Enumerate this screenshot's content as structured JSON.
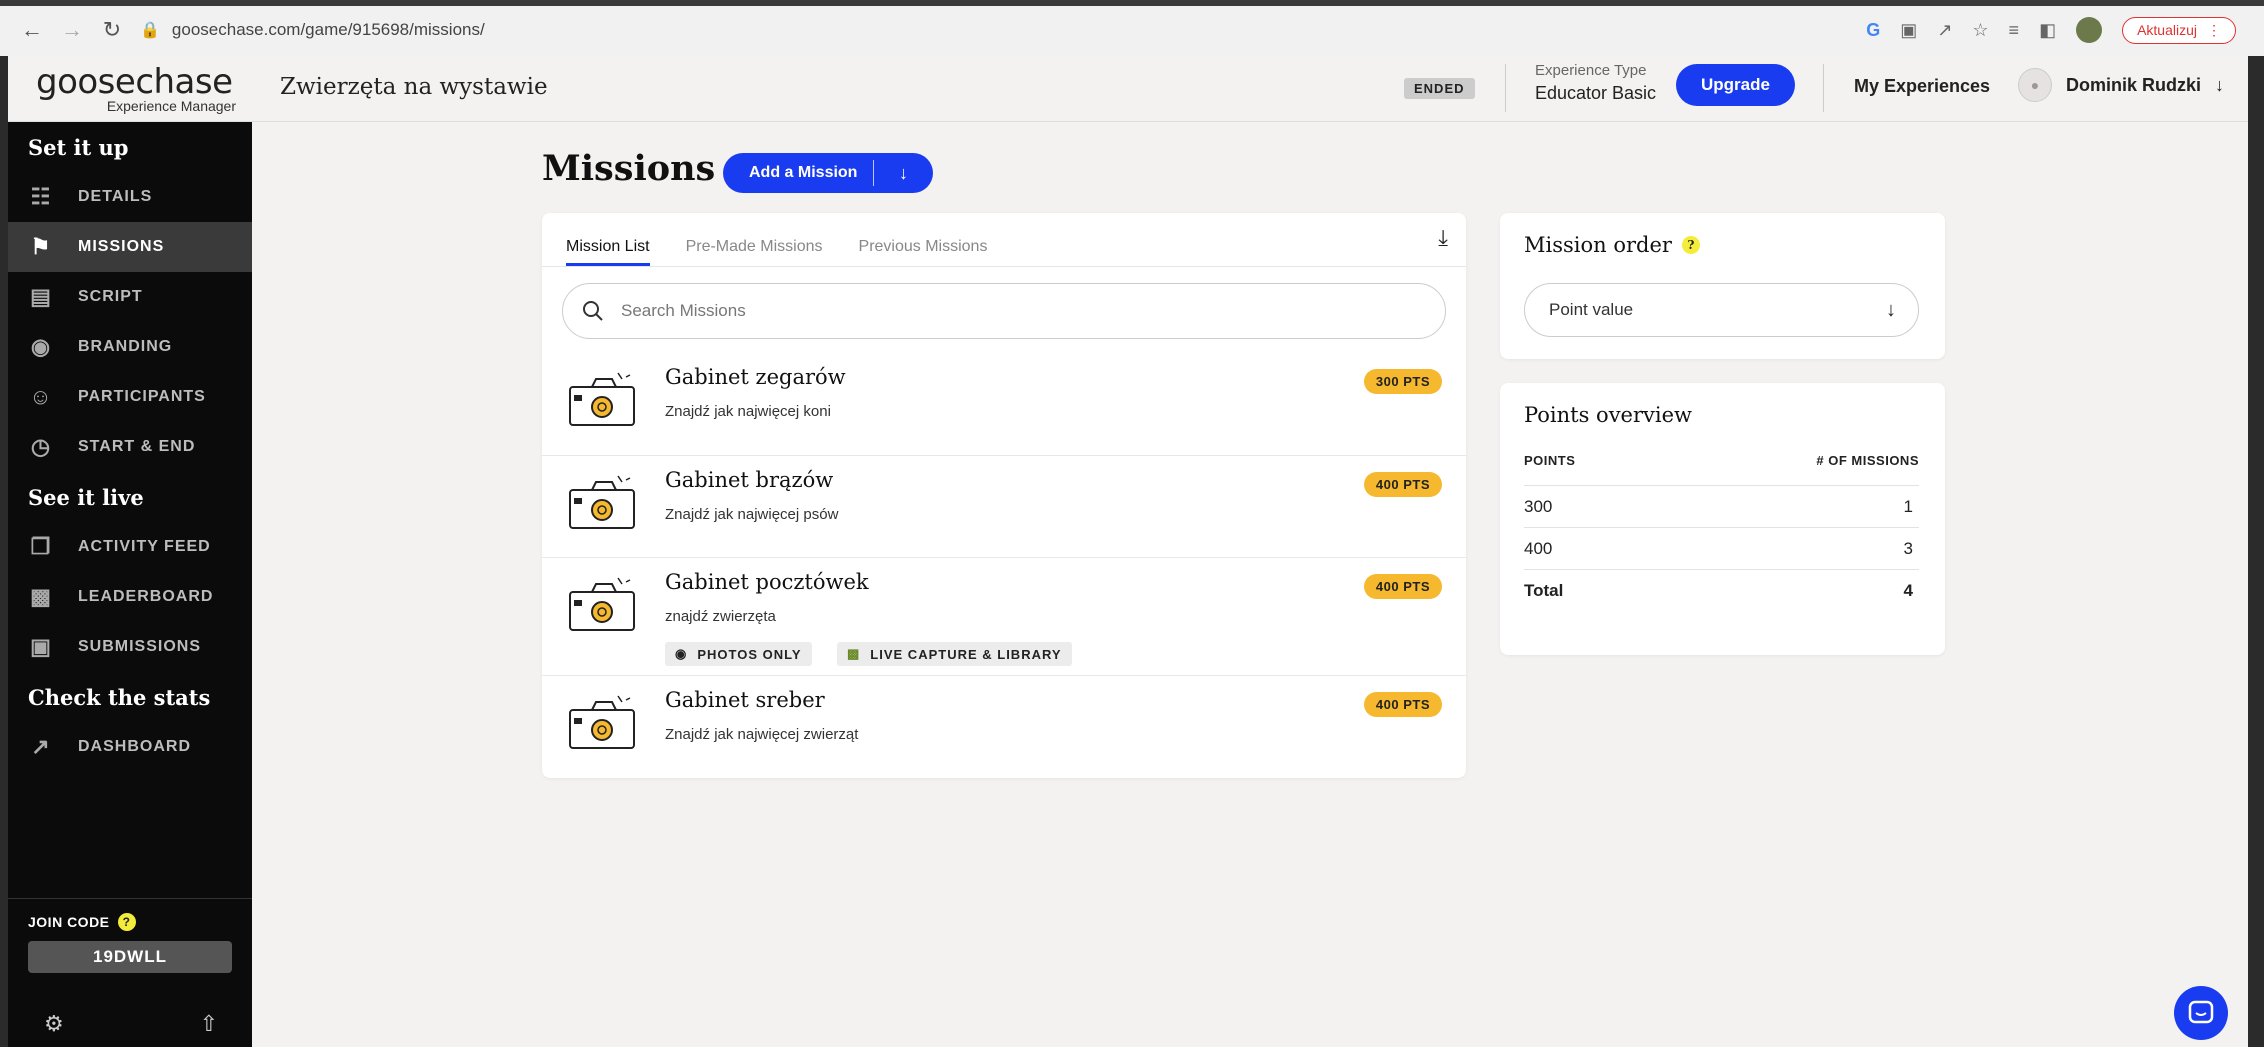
{
  "browser": {
    "url": "goosechase.com/game/915698/missions/",
    "update_label": "Aktualizuj"
  },
  "header": {
    "logo_brand": "goosechase",
    "logo_sub": "Experience Manager",
    "game_title": "Zwierzęta na wystawie",
    "status_badge": "ENDED",
    "exp_type_label": "Experience Type",
    "exp_type_value": "Educator Basic",
    "upgrade_label": "Upgrade",
    "my_experiences": "My Experiences",
    "user_name": "Dominik Rudzki"
  },
  "sidebar": {
    "sections": [
      {
        "title": "Set it up",
        "items": [
          {
            "label": "DETAILS",
            "icon": "clipboard-icon"
          },
          {
            "label": "MISSIONS",
            "icon": "flag-icon"
          },
          {
            "label": "SCRIPT",
            "icon": "clapperboard-icon"
          },
          {
            "label": "BRANDING",
            "icon": "palette-icon"
          },
          {
            "label": "PARTICIPANTS",
            "icon": "people-icon"
          },
          {
            "label": "START & END",
            "icon": "stopwatch-icon"
          }
        ]
      },
      {
        "title": "See it live",
        "items": [
          {
            "label": "ACTIVITY FEED",
            "icon": "feed-icon"
          },
          {
            "label": "LEADERBOARD",
            "icon": "leaderboard-icon"
          },
          {
            "label": "SUBMISSIONS",
            "icon": "image-icon"
          }
        ]
      },
      {
        "title": "Check the stats",
        "items": [
          {
            "label": "DASHBOARD",
            "icon": "trend-icon"
          }
        ]
      }
    ],
    "join_code_label": "JOIN CODE",
    "join_code": "19DWLL"
  },
  "main": {
    "title": "Missions",
    "add_mission_label": "Add a Mission",
    "tabs": [
      "Mission List",
      "Pre-Made Missions",
      "Previous Missions"
    ],
    "search_placeholder": "Search Missions",
    "missions": [
      {
        "name": "Gabinet zegarów",
        "desc": "Znajdź jak najwięcej koni",
        "points": "300 PTS"
      },
      {
        "name": "Gabinet brązów",
        "desc": "Znajdź jak najwięcej psów",
        "points": "400 PTS"
      },
      {
        "name": "Gabinet pocztówek",
        "desc": "znajdź zwierzęta",
        "points": "400 PTS",
        "tags": [
          "PHOTOS ONLY",
          "LIVE CAPTURE & LIBRARY"
        ]
      },
      {
        "name": "Gabinet sreber",
        "desc": "Znajdź jak najwięcej zwierząt",
        "points": "400 PTS"
      }
    ]
  },
  "mission_order": {
    "title": "Mission order",
    "help": "?",
    "selected": "Point value"
  },
  "points_overview": {
    "title": "Points overview",
    "col_points": "POINTS",
    "col_missions": "# OF MISSIONS",
    "rows": [
      {
        "points": "300",
        "count": "1"
      },
      {
        "points": "400",
        "count": "3"
      }
    ],
    "total_label": "Total",
    "total_value": "4"
  },
  "colors": {
    "accent": "#1a3cf0",
    "points_badge": "#f5b82e",
    "sidebar_bg": "#0b0b0b",
    "page_bg": "#f4f1f1"
  }
}
